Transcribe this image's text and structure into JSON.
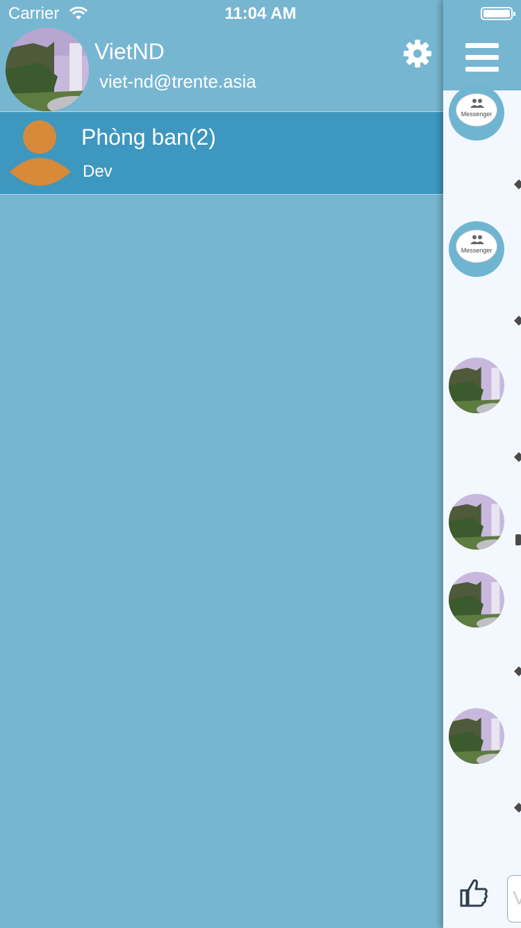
{
  "status_bar": {
    "carrier": "Carrier",
    "time": "11:04 AM"
  },
  "drawer": {
    "user_name": "VietND",
    "user_email": "viet-nd@trente.asia",
    "settings_icon": "gear-icon",
    "department": {
      "title": "Phòng ban(2)",
      "subtitle": "Dev"
    }
  },
  "main": {
    "menu_icon": "hamburger-icon",
    "group_avatar_label": "Messenger",
    "like_icon": "thumbs-up-icon",
    "colors": {
      "header": "#77b6d1",
      "selected_row": "#3d97bf",
      "avatar_orange": "#d68a3a"
    }
  }
}
